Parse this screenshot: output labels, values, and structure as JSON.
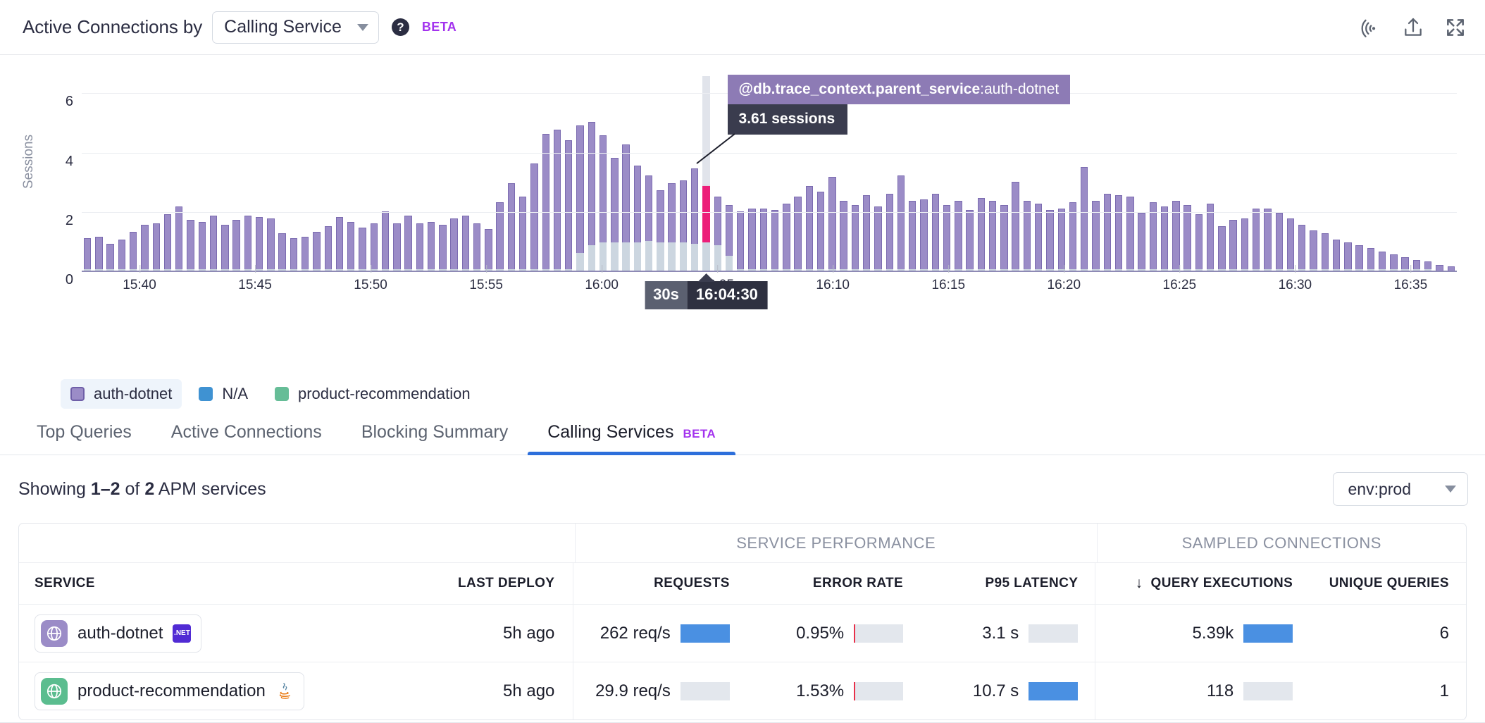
{
  "header": {
    "title": "Active Connections by",
    "group_by_value": "Calling Service",
    "help_icon": "question-mark-icon",
    "beta_label": "BETA",
    "actions": [
      {
        "name": "live-tail-icon",
        "label": "Live Tail"
      },
      {
        "name": "export-icon",
        "label": "Export"
      },
      {
        "name": "fullscreen-icon",
        "label": "Fullscreen"
      }
    ]
  },
  "chart_data": {
    "type": "bar",
    "title": "Active Connections by Calling Service",
    "xlabel": "",
    "ylabel": "Sessions",
    "ylim": [
      0,
      6.6
    ],
    "yticks": [
      0,
      2,
      4,
      6
    ],
    "grid": true,
    "legend_position": "bottom-left",
    "xticks": [
      "15:40",
      "15:45",
      "15:50",
      "15:55",
      "16:00",
      "16:05",
      "16:10",
      "16:15",
      "16:20",
      "16:25",
      "16:30",
      "16:35"
    ],
    "x_axis_start": "15:37:30",
    "x_axis_end": "16:37:00",
    "bucket_size": "30s",
    "stacked": true,
    "highlight_index": 54,
    "tooltip": {
      "title_key": "@db.trace_context.parent_service",
      "title_value": ":auth-dotnet",
      "value": "3.61 sessions"
    },
    "x_cursor": {
      "interval": "30s",
      "time": "16:04:30"
    },
    "legend": [
      {
        "label": "auth-dotnet",
        "color": "#9b8cc7",
        "active": true
      },
      {
        "label": "N/A",
        "color": "#3f92d2",
        "active": false
      },
      {
        "label": "product-recommendation",
        "color": "#66bd97",
        "active": false
      }
    ],
    "series": [
      {
        "name": "N/A",
        "color": "#ccd6e0",
        "values": [
          0.05,
          0.05,
          0.05,
          0.05,
          0.05,
          0.05,
          0.05,
          0.05,
          0.05,
          0.05,
          0.05,
          0.05,
          0.05,
          0.05,
          0.05,
          0.05,
          0.05,
          0.05,
          0.05,
          0.05,
          0.05,
          0.05,
          0.05,
          0.05,
          0.05,
          0.05,
          0.05,
          0.05,
          0.05,
          0.05,
          0.05,
          0.05,
          0.05,
          0.05,
          0.05,
          0.05,
          0.05,
          0.05,
          0.05,
          0.05,
          0.05,
          0.05,
          0.05,
          0.6,
          0.85,
          0.95,
          0.95,
          0.95,
          0.95,
          1.0,
          0.95,
          0.95,
          0.95,
          0.9,
          0.95,
          0.85,
          0.5,
          0.05,
          0.05,
          0.05,
          0.05,
          0.05,
          0.05,
          0.05,
          0.05,
          0.05,
          0.05,
          0.05,
          0.05,
          0.05,
          0.05,
          0.05,
          0.05,
          0.05,
          0.05,
          0.05,
          0.05,
          0.05,
          0.05,
          0.05,
          0.05,
          0.05,
          0.05,
          0.05,
          0.05,
          0.05,
          0.05,
          0.05,
          0.05,
          0.05,
          0.05,
          0.05,
          0.05,
          0.05,
          0.05,
          0.05,
          0.05,
          0.05,
          0.05,
          0.05,
          0.05,
          0.05,
          0.05,
          0.05,
          0.05,
          0.05,
          0.05,
          0.05,
          0.05,
          0.05,
          0.05,
          0.05,
          0.05,
          0.05,
          0.05,
          0.05,
          0.05,
          0.05
        ]
      },
      {
        "name": "auth-dotnet",
        "color": "#9b8cc7",
        "values": [
          1.05,
          1.1,
          0.85,
          1.0,
          1.25,
          1.5,
          1.55,
          1.85,
          2.1,
          1.65,
          1.6,
          1.8,
          1.5,
          1.65,
          1.8,
          1.75,
          1.7,
          1.2,
          1.05,
          1.1,
          1.25,
          1.45,
          1.75,
          1.6,
          1.4,
          1.55,
          1.95,
          1.55,
          1.8,
          1.55,
          1.6,
          1.5,
          1.7,
          1.8,
          1.55,
          1.35,
          2.25,
          2.9,
          2.45,
          3.55,
          4.55,
          4.7,
          4.35,
          4.3,
          4.15,
          3.6,
          2.85,
          3.3,
          2.6,
          2.2,
          1.75,
          2.0,
          2.1,
          2.55,
          1.95,
          1.65,
          1.7,
          1.95,
          2.05,
          2.05,
          2.0,
          2.2,
          2.45,
          2.8,
          2.6,
          3.1,
          2.3,
          2.15,
          2.5,
          2.1,
          2.55,
          3.15,
          2.3,
          2.35,
          2.55,
          2.15,
          2.3,
          2.0,
          2.4,
          2.3,
          2.15,
          2.95,
          2.3,
          2.2,
          2.0,
          2.05,
          2.25,
          3.45,
          2.3,
          2.55,
          2.5,
          2.45,
          1.9,
          2.25,
          2.1,
          2.3,
          2.15,
          1.85,
          2.2,
          1.45,
          1.65,
          1.7,
          2.05,
          2.05,
          1.9,
          1.7,
          1.5,
          1.3,
          1.2,
          1.0,
          0.9,
          0.8,
          0.7,
          0.6,
          0.5,
          0.4,
          0.3,
          0.25,
          0.2,
          0.15
        ]
      }
    ],
    "highlight_value": 3.61,
    "highlight_color": "#ec1e79"
  },
  "tabs": [
    {
      "label": "Top Queries",
      "active": false,
      "beta": ""
    },
    {
      "label": "Active Connections",
      "active": false,
      "beta": ""
    },
    {
      "label": "Blocking Summary",
      "active": false,
      "beta": ""
    },
    {
      "label": "Calling Services",
      "active": true,
      "beta": "BETA"
    }
  ],
  "results": {
    "showing_prefix": "Showing ",
    "showing_range": "1–2",
    "showing_mid": " of ",
    "showing_total": "2",
    "showing_suffix": " APM services",
    "env_filter": "env:prod"
  },
  "table": {
    "group_headers": [
      {
        "label": "",
        "span": "service"
      },
      {
        "label": "SERVICE PERFORMANCE",
        "span": "perf"
      },
      {
        "label": "SAMPLED CONNECTIONS",
        "span": "sampled"
      }
    ],
    "columns": [
      {
        "key": "service",
        "label": "SERVICE",
        "align": "left"
      },
      {
        "key": "last_deploy",
        "label": "LAST DEPLOY",
        "align": "right"
      },
      {
        "key": "requests",
        "label": "REQUESTS",
        "align": "right"
      },
      {
        "key": "error_rate",
        "label": "ERROR RATE",
        "align": "right"
      },
      {
        "key": "p95_latency",
        "label": "P95 LATENCY",
        "align": "right"
      },
      {
        "key": "query_executions",
        "label": "QUERY EXECUTIONS",
        "align": "right",
        "sorted": "desc",
        "sort_glyph": "↓"
      },
      {
        "key": "unique_queries",
        "label": "UNIQUE QUERIES",
        "align": "right"
      }
    ],
    "rows": [
      {
        "service": "auth-dotnet",
        "service_icon": "globe-icon",
        "service_icon_color": "#9b8cc7",
        "lang": ".NET",
        "lang_type": "dotnet",
        "last_deploy": "5h ago",
        "requests": "262 req/s",
        "requests_pct": 100,
        "error_rate": "0.95%",
        "error_rate_pct": 3,
        "p95_latency": "3.1 s",
        "p95_pct": 0,
        "query_executions": "5.39k",
        "query_exec_pct": 100,
        "unique_queries": "6"
      },
      {
        "service": "product-recommendation",
        "service_icon": "globe-icon",
        "service_icon_color": "#5bbd8f",
        "lang": "java",
        "lang_type": "java",
        "last_deploy": "5h ago",
        "requests": "29.9 req/s",
        "requests_pct": 0,
        "error_rate": "1.53%",
        "error_rate_pct": 3,
        "p95_latency": "10.7 s",
        "p95_pct": 100,
        "query_executions": "118",
        "query_exec_pct": 0,
        "unique_queries": "1"
      }
    ]
  }
}
